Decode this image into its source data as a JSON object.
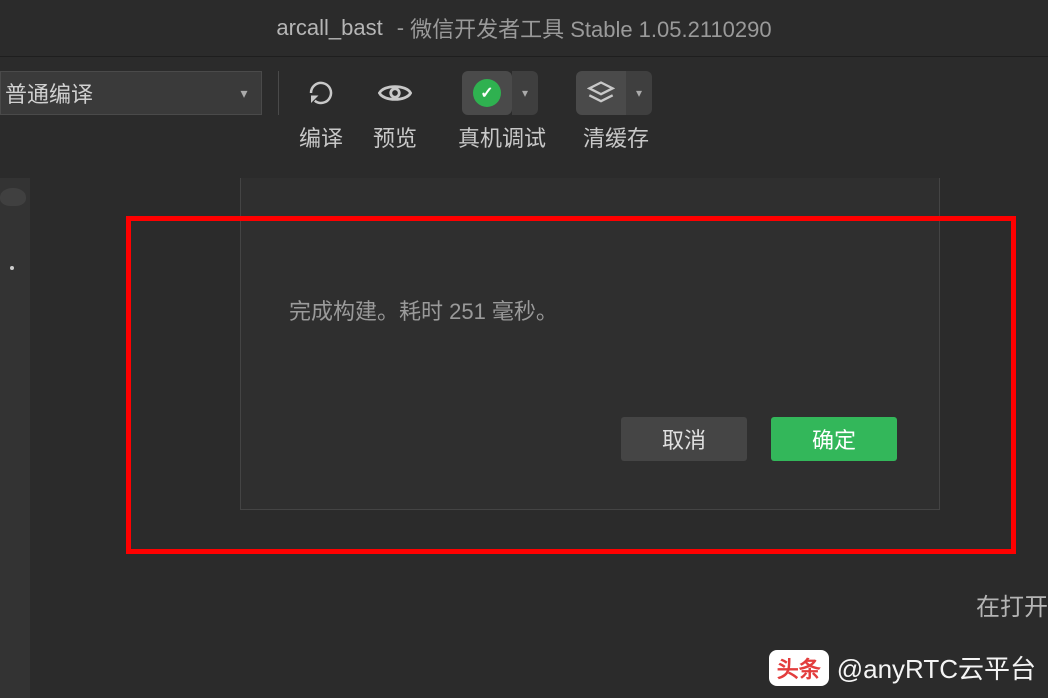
{
  "titlebar": {
    "project": "arcall_bast",
    "separator": "-",
    "app": "微信开发者工具 Stable 1.05.2110290"
  },
  "compile_mode": {
    "label": "普通编译"
  },
  "toolbar": {
    "compile": "编译",
    "preview": "预览",
    "debug": "真机调试",
    "clear_cache": "清缓存"
  },
  "dialog": {
    "message": "完成构建。耗时 251 毫秒。",
    "cancel": "取消",
    "ok": "确定"
  },
  "corner_text": "在打开",
  "watermark": {
    "badge": "头条",
    "handle": "@anyRTC云平台"
  },
  "colors": {
    "accent_green": "#33b75a",
    "highlight_red": "#ff0000"
  }
}
